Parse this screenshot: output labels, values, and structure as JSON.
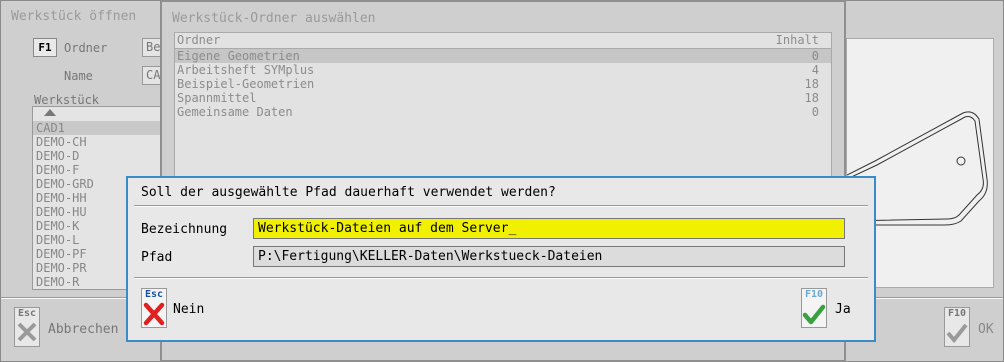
{
  "open_window": {
    "title": "Werkstück öffnen",
    "f1_key": "F1",
    "ordner_label": "Ordner",
    "ordner_value": "Be",
    "name_label": "Name",
    "name_value": "CA",
    "werkstueck_label": "Werkstück",
    "items": [
      "CAD1",
      "DEMO-CH",
      "DEMO-D",
      "DEMO-F",
      "DEMO-GRD",
      "DEMO-HH",
      "DEMO-HU",
      "DEMO-K",
      "DEMO-L",
      "DEMO-PF",
      "DEMO-PR",
      "DEMO-R"
    ],
    "esc_key": "Esc",
    "cancel_label": "Abbrechen",
    "f10_key": "F10",
    "ok_label": "OK"
  },
  "folder_window": {
    "title": "Werkstück-Ordner auswählen",
    "col_folder": "Ordner",
    "col_content": "Inhalt",
    "rows": [
      {
        "name": "Eigene Geometrien",
        "count": "0"
      },
      {
        "name": "Arbeitsheft SYMplus",
        "count": "4"
      },
      {
        "name": "Beispiel-Geometrien",
        "count": "18"
      },
      {
        "name": "Spannmittel",
        "count": "18"
      },
      {
        "name": "Gemeinsame Daten",
        "count": "0"
      }
    ]
  },
  "dialog": {
    "title": "Soll der ausgewählte Pfad dauerhaft verwendet werden?",
    "bezeichnung_label": "Bezeichnung",
    "bezeichnung_value": "Werkstück-Dateien auf dem Server_",
    "pfad_label": "Pfad",
    "pfad_value": "P:\\Fertigung\\KELLER-Daten\\Werkstueck-Dateien",
    "no_key": "Esc",
    "no_label": "Nein",
    "yes_key": "F10",
    "yes_label": "Ja"
  },
  "colors": {
    "dialog_border": "#3a8cc8",
    "field_highlight": "#f0f000",
    "no_icon": "#e02020",
    "yes_icon": "#3aa040"
  }
}
